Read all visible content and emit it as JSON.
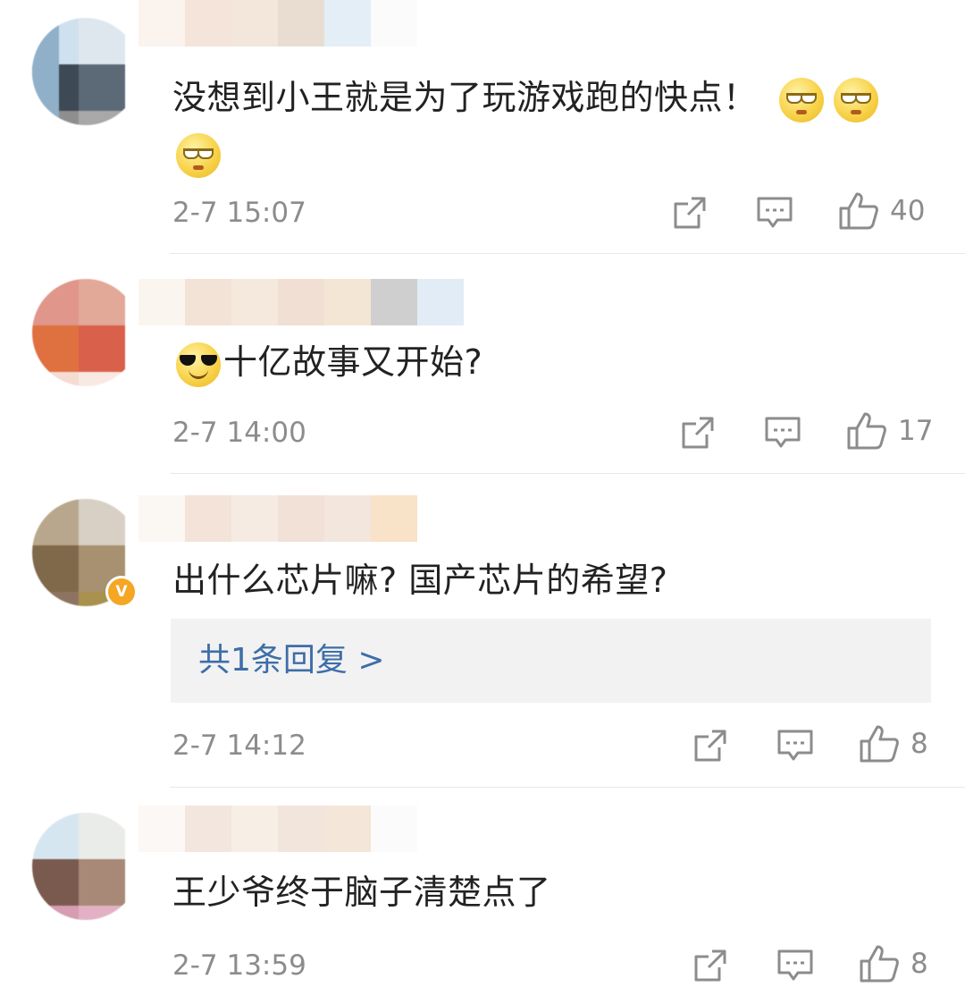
{
  "comments": [
    {
      "text": "没想到小王就是为了玩游戏跑的快点！",
      "time": "2-7 15:07",
      "likes": "40",
      "trailing_emojis": [
        "eye-roll-emoji",
        "eye-roll-emoji",
        "eye-roll-emoji"
      ]
    },
    {
      "text": "十亿故事又开始?",
      "time": "2-7 14:00",
      "likes": "17",
      "leading_emoji": "sunglasses-emoji"
    },
    {
      "text": "出什么芯片嘛? 国产芯片的希望?",
      "time": "2-7 14:12",
      "likes": "8",
      "reply_link": "共1条回复 >",
      "verified_badge": "V"
    },
    {
      "text": "王少爷终于脑子清楚点了",
      "time": "2-7 13:59",
      "likes": "8"
    }
  ],
  "icons": [
    "share-icon",
    "comment-icon",
    "like-icon"
  ],
  "colors": {
    "text": "#222222",
    "meta": "#8c8c8c",
    "link": "#3d6ea8",
    "reply_bg": "#f2f2f2",
    "badge": "#f5a623"
  }
}
